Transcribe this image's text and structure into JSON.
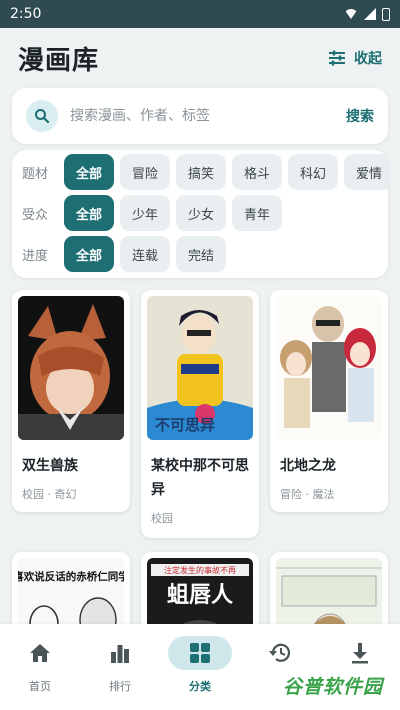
{
  "status_bar": {
    "time": "2:50"
  },
  "header": {
    "title": "漫画库",
    "collapse_label": "收起",
    "collapse_icon": "sliders-icon"
  },
  "search": {
    "placeholder": "搜索漫画、作者、标签",
    "button_label": "搜索"
  },
  "filters": [
    {
      "label": "题材",
      "options": [
        "全部",
        "冒险",
        "搞笑",
        "格斗",
        "科幻",
        "爱情"
      ],
      "selected": "全部"
    },
    {
      "label": "受众",
      "options": [
        "全部",
        "少年",
        "少女",
        "青年"
      ],
      "selected": "全部"
    },
    {
      "label": "进度",
      "options": [
        "全部",
        "连载",
        "完结"
      ],
      "selected": "全部"
    }
  ],
  "comics": [
    {
      "title": "双生兽族",
      "tags": "校园 · 奇幻"
    },
    {
      "title": "某校中那不可思异",
      "tags": "校园"
    },
    {
      "title": "北地之龙",
      "tags": "冒险 · 魔法"
    },
    {
      "cover_text": "喜欢说反话的赤桥仁同学"
    },
    {
      "cover_text": "蛆唇人",
      "cover_banner": "注定发生的事故不再"
    },
    {
      "title": ""
    }
  ],
  "bottom_nav": [
    {
      "label": "首页",
      "icon": "home-icon"
    },
    {
      "label": "排行",
      "icon": "ranking-icon"
    },
    {
      "label": "分类",
      "icon": "category-icon",
      "active": true
    },
    {
      "label": "",
      "icon": "history-icon"
    },
    {
      "label": "",
      "icon": "download-icon"
    }
  ],
  "watermark": {
    "text": "谷普软件园"
  },
  "colors": {
    "accent": "#1d6f74",
    "accent_light": "#cfe7ea",
    "background": "#eef2f3"
  }
}
